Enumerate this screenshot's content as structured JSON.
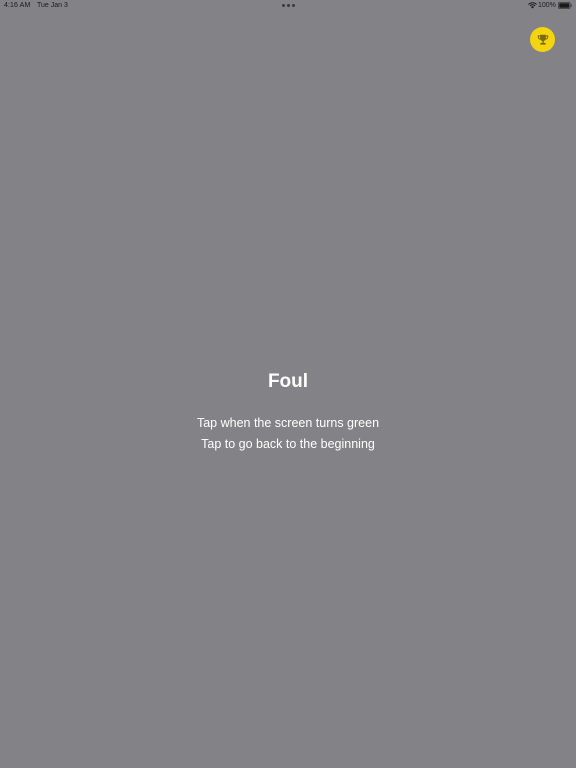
{
  "status_bar": {
    "time": "4:16 AM",
    "date": "Tue Jan 3",
    "battery": "100%"
  },
  "colors": {
    "background": "#838286",
    "trophy_badge": "#f4d40e",
    "trophy_glyph": "#7a6a10",
    "text": "#ffffff"
  },
  "toolbar": {
    "trophy_icon": "trophy-icon"
  },
  "screen": {
    "title": "Foul",
    "instruction": "Tap when the screen turns green",
    "restart_hint": "Tap to go back to the beginning"
  }
}
